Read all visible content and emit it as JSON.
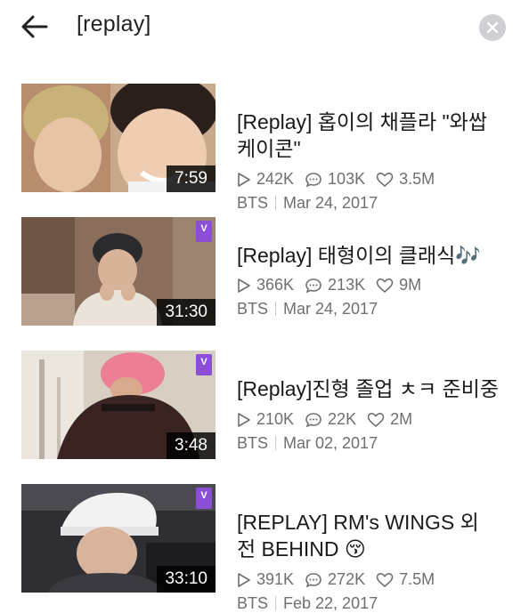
{
  "search": {
    "query": "[replay]"
  },
  "results": [
    {
      "title_line1": "[Replay] 홉이의 채플라 \"와쌉",
      "title_line2": "케이콘\"",
      "duration": "7:59",
      "plays": "242K",
      "comments": "103K",
      "likes": "3.5M",
      "channel": "BTS",
      "date": "Mar 24, 2017",
      "badge": ""
    },
    {
      "title_line1": "[Replay] 태형이의 클래식🎶",
      "title_line2": "",
      "duration": "31:30",
      "plays": "366K",
      "comments": "213K",
      "likes": "9M",
      "channel": "BTS",
      "date": "Mar 24, 2017",
      "badge": "V"
    },
    {
      "title_line1": "[Replay]진형 졸업 ㅊㅋ 준비중",
      "title_line2": "",
      "duration": "3:48",
      "plays": "210K",
      "comments": "22K",
      "likes": "2M",
      "channel": "BTS",
      "date": "Mar 02, 2017",
      "badge": "V"
    },
    {
      "title_line1": "[REPLAY] RM's WINGS 외",
      "title_line2": "전 BEHIND 😚",
      "duration": "33:10",
      "plays": "391K",
      "comments": "272K",
      "likes": "7.5M",
      "channel": "BTS",
      "date": "Feb 22, 2017",
      "badge": "V"
    }
  ],
  "icons": {
    "back": "arrow-left-icon",
    "clear": "close-icon",
    "plays": "play-icon",
    "comments": "comment-icon",
    "likes": "heart-icon"
  },
  "colors": {
    "badge": "#8b4fd6",
    "meta": "#6f6f6f",
    "clear_bg": "#cfcfd4"
  }
}
